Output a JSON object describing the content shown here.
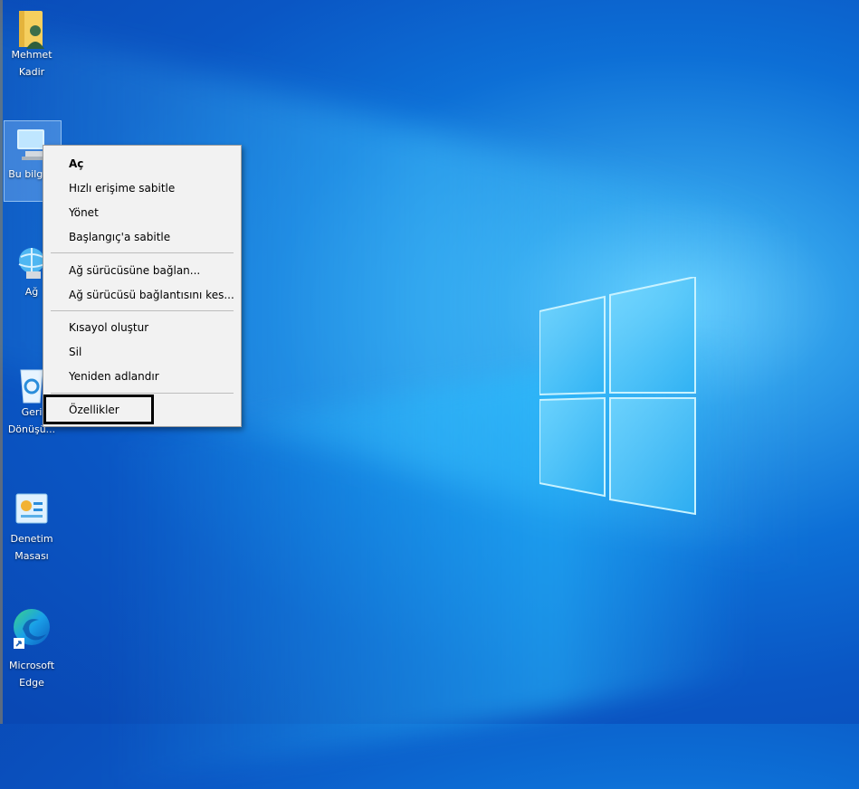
{
  "desktop": {
    "icons": [
      {
        "label_line1": "Mehmet",
        "label_line2": "Kadir",
        "icon": "user-folder-icon"
      },
      {
        "label_line1": "Bu bilgisa",
        "label_line2": "",
        "icon": "this-pc-icon"
      },
      {
        "label_line1": "Ağ",
        "label_line2": "",
        "icon": "network-icon"
      },
      {
        "label_line1": "Geri",
        "label_line2": "Dönüşü...",
        "icon": "recycle-bin-icon"
      },
      {
        "label_line1": "Denetim",
        "label_line2": "Masası",
        "icon": "control-panel-icon"
      },
      {
        "label_line1": "Microsoft",
        "label_line2": "Edge",
        "icon": "edge-icon"
      }
    ]
  },
  "context_menu": {
    "items": [
      {
        "label": "Aç",
        "bold": true
      },
      {
        "label": "Hızlı erişime sabitle"
      },
      {
        "label": "Yönet"
      },
      {
        "label": "Başlangıç'a sabitle"
      },
      {
        "label": "Ağ sürücüsüne bağlan..."
      },
      {
        "label": "Ağ sürücüsü bağlantısını kes..."
      },
      {
        "label": "Kısayol oluştur"
      },
      {
        "label": "Sil"
      },
      {
        "label": "Yeniden adlandır"
      },
      {
        "label": "Özellikler"
      }
    ]
  },
  "colors": {
    "desktop_blue": "#0a56c4",
    "menu_bg": "#f2f2f2",
    "highlight_border": "#000000"
  }
}
